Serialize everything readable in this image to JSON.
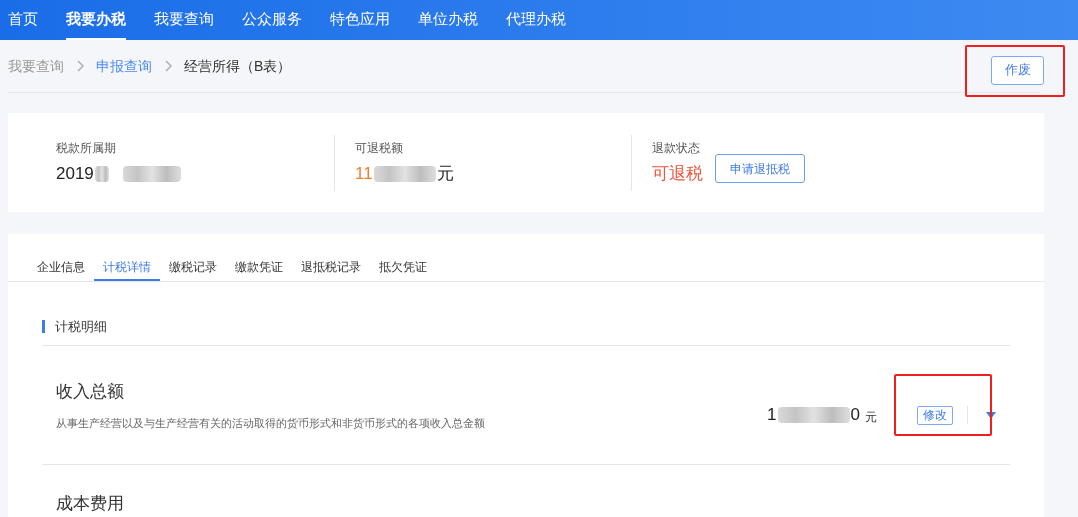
{
  "nav": [
    {
      "label": "首页",
      "selected": false
    },
    {
      "label": "我要办税",
      "selected": true
    },
    {
      "label": "我要查询",
      "selected": false
    },
    {
      "label": "公众服务",
      "selected": false
    },
    {
      "label": "特色应用",
      "selected": false
    },
    {
      "label": "单位办税",
      "selected": false
    },
    {
      "label": "代理办税",
      "selected": false
    }
  ],
  "breadcrumb": [
    {
      "label": "我要查询",
      "kind": "plain"
    },
    {
      "label": "申报查询",
      "kind": "link"
    },
    {
      "label": "经营所得（B表）",
      "kind": "current"
    }
  ],
  "void_button": "作废",
  "summary": {
    "period": {
      "label": "税款所属期",
      "value_start": "2019"
    },
    "refundable": {
      "label": "可退税额",
      "value_start": "11",
      "unit": "元"
    },
    "status": {
      "label": "退款状态",
      "value": "可退税",
      "button": "申请退抵税"
    }
  },
  "tabs": [
    {
      "label": "企业信息",
      "selected": false
    },
    {
      "label": "计税详情",
      "selected": true
    },
    {
      "label": "缴税记录",
      "selected": false
    },
    {
      "label": "缴款凭证",
      "selected": false
    },
    {
      "label": "退抵税记录",
      "selected": false
    },
    {
      "label": "抵欠凭证",
      "selected": false
    }
  ],
  "section_title": "计税明细",
  "items": [
    {
      "title": "收入总额",
      "description": "从事生产经营以及与生产经营有关的活动取得的货币形式和非货币形式的各项收入总金额",
      "value_start": "1",
      "value_end": "0",
      "unit": "元",
      "button": "修改",
      "expanded": false
    },
    {
      "title": "成本费用"
    }
  ]
}
